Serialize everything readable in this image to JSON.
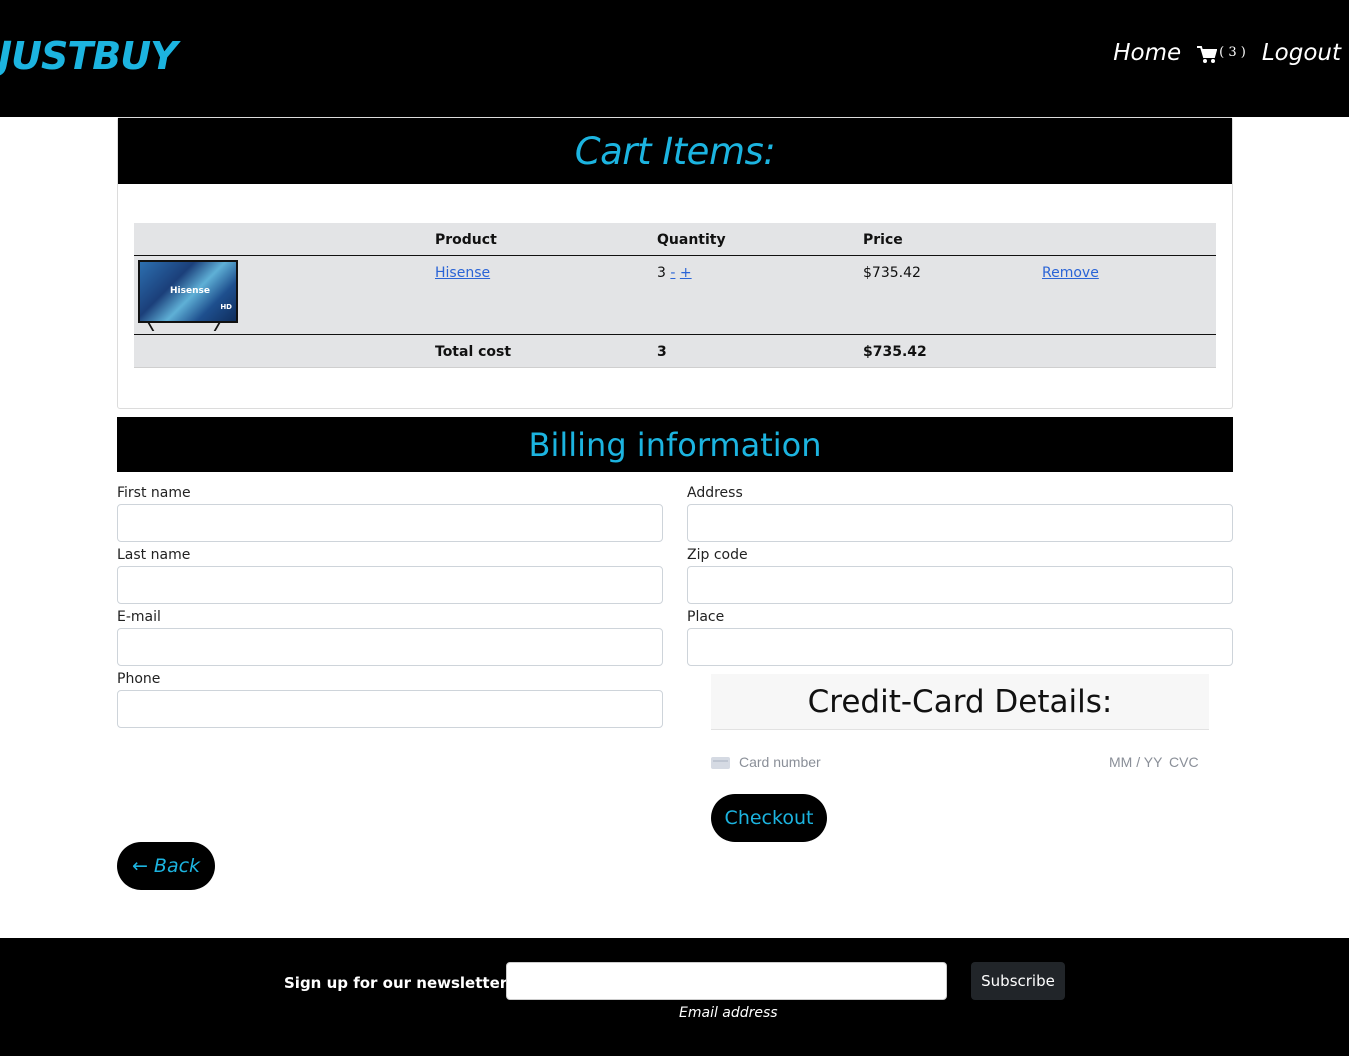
{
  "header": {
    "brand": "JUSTBUY",
    "nav": {
      "home": "Home",
      "cart_count": "( 3 )",
      "logout": "Logout"
    }
  },
  "cart": {
    "title": "Cart Items:",
    "columns": {
      "product": "Product",
      "quantity": "Quantity",
      "price": "Price"
    },
    "items": [
      {
        "thumb_brand": "Hisense",
        "thumb_badge": "HD",
        "product": "Hisense",
        "quantity": "3",
        "decrement": "-",
        "increment": "+",
        "price": "$735.42",
        "remove": "Remove"
      }
    ],
    "total": {
      "label": "Total cost",
      "quantity": "3",
      "price": "$735.42"
    }
  },
  "billing": {
    "title": "Billing information",
    "fields": {
      "first_name": "First name",
      "last_name": "Last name",
      "email": "E-mail",
      "phone": "Phone",
      "address": "Address",
      "zip": "Zip code",
      "place": "Place"
    }
  },
  "credit_card": {
    "title": "Credit-Card Details:",
    "card_placeholder": "Card number",
    "expiry_placeholder": "MM / YY",
    "cvc_placeholder": "CVC"
  },
  "actions": {
    "checkout": "Checkout",
    "back": "← Back"
  },
  "footer": {
    "newsletter_label": "Sign up for our newsletter",
    "email_hint": "Email address",
    "subscribe": "Subscribe"
  },
  "colors": {
    "accent": "#1cb4e0",
    "header_bg": "#000000",
    "table_bg": "#e3e4e6",
    "link": "#2a64d6"
  }
}
